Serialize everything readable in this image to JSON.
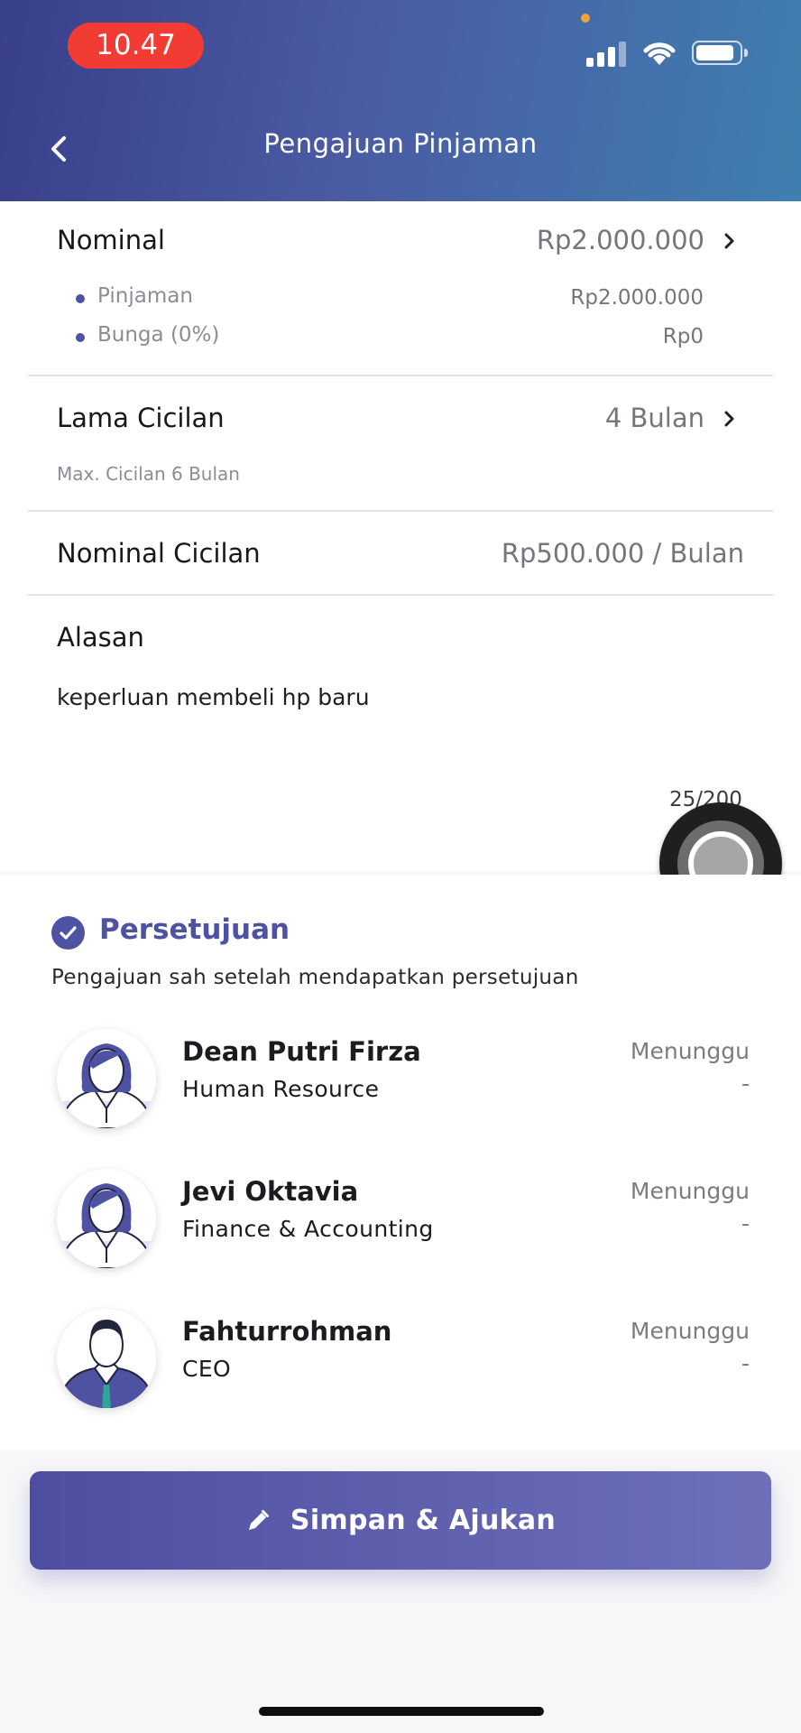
{
  "status_bar": {
    "time": "10.47"
  },
  "header": {
    "title": "Pengajuan Pinjaman"
  },
  "nominal": {
    "label": "Nominal",
    "value": "Rp2.000.000",
    "breakdown": [
      {
        "label": "Pinjaman",
        "value": "Rp2.000.000"
      },
      {
        "label": "Bunga (0%)",
        "value": "Rp0"
      }
    ]
  },
  "lama_cicilan": {
    "label": "Lama Cicilan",
    "value": "4 Bulan",
    "note": "Max. Cicilan 6 Bulan"
  },
  "nominal_cicilan": {
    "label": "Nominal Cicilan",
    "value": "Rp500.000 / Bulan"
  },
  "alasan": {
    "label": "Alasan",
    "text": "keperluan membeli hp baru",
    "counter": "25/200"
  },
  "persetujuan": {
    "title": "Persetujuan",
    "subtitle": "Pengajuan sah setelah mendapatkan persetujuan",
    "approvers": [
      {
        "name": "Dean Putri Firza",
        "role": "Human Resource",
        "status": "Menunggu",
        "date": "-"
      },
      {
        "name": "Jevi Oktavia",
        "role": "Finance & Accounting",
        "status": "Menunggu",
        "date": "-"
      },
      {
        "name": "Fahturrohman",
        "role": "CEO",
        "status": "Menunggu",
        "date": "-"
      }
    ]
  },
  "submit": {
    "label": "Simpan & Ajukan"
  },
  "colors": {
    "primary": "#4e52a3",
    "status_red": "#f23b33"
  }
}
